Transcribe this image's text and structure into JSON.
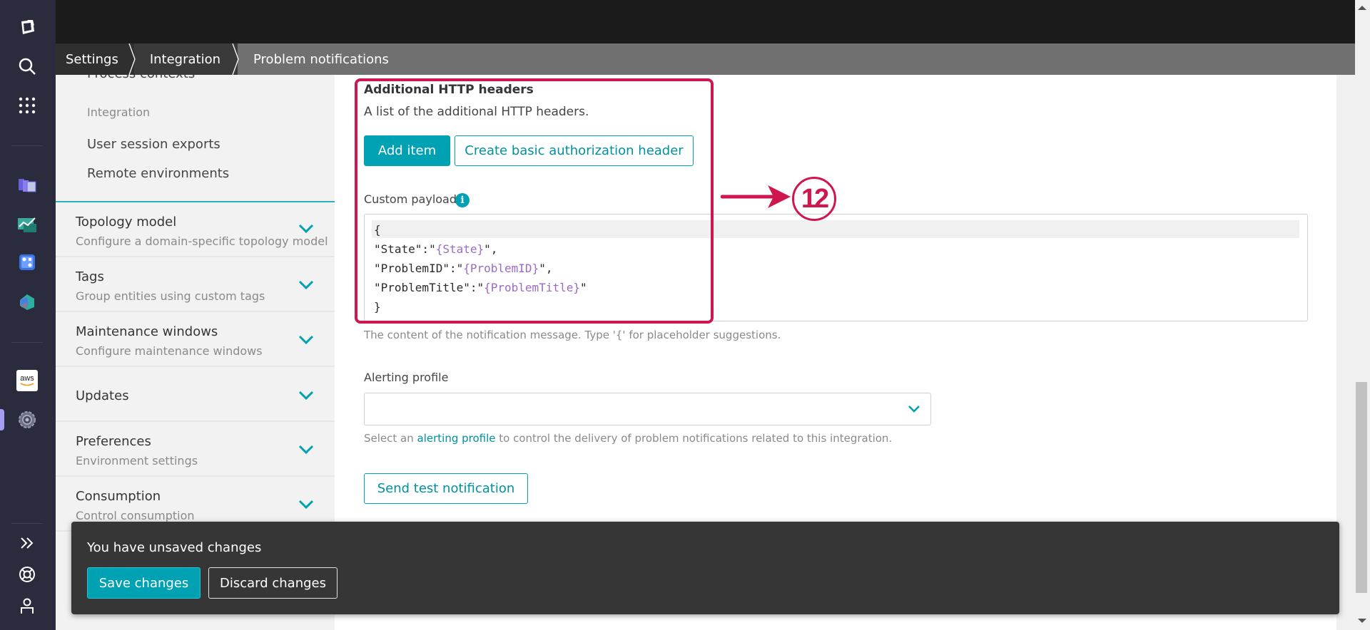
{
  "rail": {
    "icons": [
      "dynatrace-logo-icon",
      "search-icon",
      "apps-grid-icon",
      "infrastructure-icon",
      "dashboards-icon",
      "workflows-icon",
      "app-icon",
      "aws-icon",
      "settings-gear-icon",
      "expand-icon",
      "help-icon",
      "user-icon"
    ],
    "aws_label": "aws"
  },
  "breadcrumb": [
    {
      "label": "Settings"
    },
    {
      "label": "Integration"
    },
    {
      "label": "Problem notifications"
    }
  ],
  "sidenav": {
    "cut_item": "Process contexts",
    "group_heading": "Integration",
    "sub_items": [
      "User session exports",
      "Remote environments"
    ],
    "sections": [
      {
        "title": "Topology model",
        "desc": "Configure a domain-specific topology model"
      },
      {
        "title": "Tags",
        "desc": "Group entities using custom tags"
      },
      {
        "title": "Maintenance windows",
        "desc": "Configure maintenance windows"
      },
      {
        "title": "Updates",
        "desc": ""
      },
      {
        "title": "Preferences",
        "desc": "Environment settings"
      },
      {
        "title": "Consumption",
        "desc": "Control consumption"
      }
    ]
  },
  "main": {
    "headers_title": "Additional HTTP headers",
    "headers_desc": "A list of the additional HTTP headers.",
    "add_item_label": "Add item",
    "basic_auth_label": "Create basic authorization header",
    "payload_label": "Custom payload",
    "payload_lines": [
      [
        {
          "t": "{"
        }
      ],
      [
        {
          "t": "\"State\":\""
        },
        {
          "t": "{State}",
          "ph": true
        },
        {
          "t": "\","
        }
      ],
      [
        {
          "t": "\"ProblemID\":\""
        },
        {
          "t": "{ProblemID}",
          "ph": true
        },
        {
          "t": "\","
        }
      ],
      [
        {
          "t": "\"ProblemTitle\":\""
        },
        {
          "t": "{ProblemTitle}",
          "ph": true
        },
        {
          "t": "\""
        }
      ],
      [
        {
          "t": "}"
        }
      ]
    ],
    "payload_help": "The content of the notification message. Type '{' for placeholder suggestions.",
    "alerting_label": "Alerting profile",
    "alerting_value": "",
    "alerting_help_pre": "Select an ",
    "alerting_help_link": "alerting profile",
    "alerting_help_post": " to control the delivery of problem notifications related to this integration.",
    "send_test_label": "Send test notification"
  },
  "annotation": {
    "number": "12",
    "color": "#d0164f"
  },
  "toast": {
    "message": "You have unsaved changes",
    "save_label": "Save changes",
    "discard_label": "Discard changes"
  },
  "colors": {
    "accent": "#00a1b2",
    "rail_bg": "#2a2b3d",
    "placeholder_token": "#9b6bc4"
  }
}
